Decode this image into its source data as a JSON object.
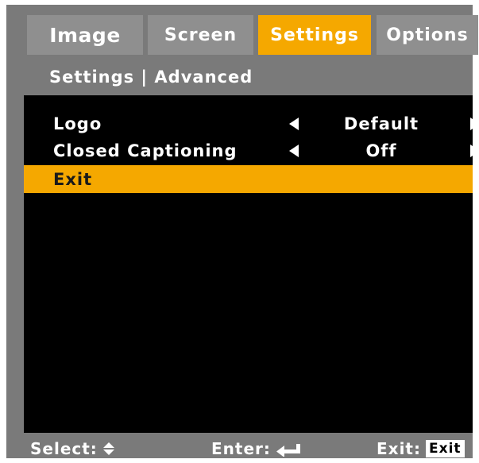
{
  "tabs": [
    {
      "label": "Image",
      "active": false
    },
    {
      "label": "Screen",
      "active": false
    },
    {
      "label": "Settings",
      "active": true
    },
    {
      "label": "Options",
      "active": false
    }
  ],
  "breadcrumb": {
    "section": "Settings",
    "separator": " | ",
    "page": "Advanced"
  },
  "menu": {
    "items": [
      {
        "label": "Logo",
        "value": "Default"
      },
      {
        "label": "Closed Captioning",
        "value": "Off"
      },
      {
        "label": "Exit",
        "selected": true
      }
    ]
  },
  "footer": {
    "select_label": "Select:",
    "select_icon": "up-down-arrows-icon",
    "enter_label": "Enter:",
    "enter_icon": "enter-return-icon",
    "exit_label": "Exit:",
    "exit_key": "Exit"
  },
  "colors": {
    "accent": "#f5a800",
    "frame": "#7a7a7a",
    "inactive_tab": "#8f8f8f",
    "panel": "#000000",
    "text": "#ffffff"
  }
}
